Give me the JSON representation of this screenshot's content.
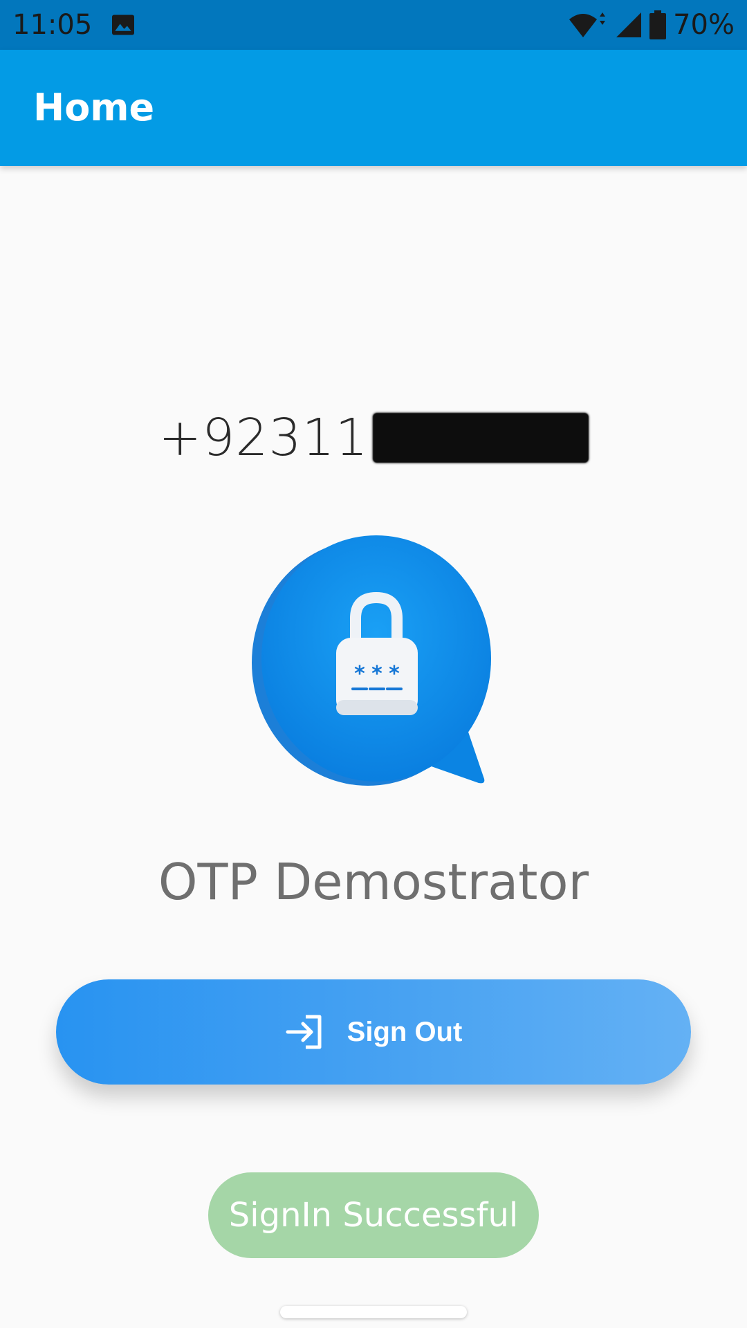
{
  "status_bar": {
    "time": "11:05",
    "battery_percent": "70%",
    "icons": [
      "image-icon",
      "wifi-icon",
      "cell-signal-icon",
      "battery-icon"
    ]
  },
  "app_bar": {
    "title": "Home"
  },
  "main": {
    "phone_number_visible": "+92311",
    "phone_number_redacted": true,
    "logo_icon": "chat-bubble-lock-icon",
    "app_name": "OTP Demostrator",
    "signout_button": {
      "label": "Sign Out",
      "icon": "sign-in-arrow-icon"
    },
    "status_pill": {
      "label": "SignIn Successful"
    }
  },
  "colors": {
    "status_bar": "#0277bd",
    "app_bar": "#039be5",
    "button_start": "#2893f1",
    "button_end": "#64b1f4",
    "success_pill": "#a5d6a7",
    "background": "#fafafa"
  }
}
